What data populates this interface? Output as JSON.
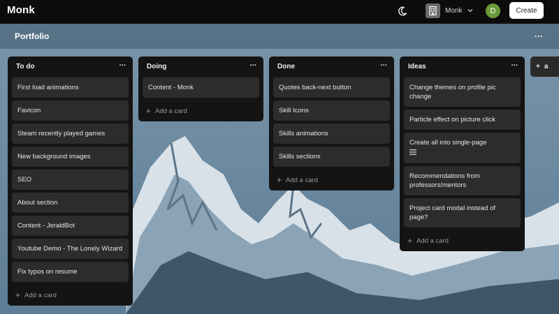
{
  "app": {
    "name": "Monk"
  },
  "topbar": {
    "workspace_name": "Monk",
    "avatar_initial": "D",
    "create_label": "Create",
    "theme_icon": "moon-icon"
  },
  "board": {
    "title": "Portfolio",
    "menu": "···"
  },
  "lists": [
    {
      "title": "To do",
      "menu": "···",
      "add_label": "Add a card",
      "cards": [
        "First load animations",
        "Favicon",
        "Steam recently played games",
        "New background images",
        "SEO",
        "About section",
        "Content - JeraldBot",
        "Youtube Demo - The Lonely Wizard",
        "Fix typos on resume"
      ]
    },
    {
      "title": "Doing",
      "menu": "···",
      "add_label": "Add a card",
      "cards": [
        "Content - Monk"
      ]
    },
    {
      "title": "Done",
      "menu": "···",
      "add_label": "Add a card",
      "cards": [
        "Quotes back-next button",
        "Skill Icons",
        "Skills animations",
        "Skills sections"
      ]
    },
    {
      "title": "Ideas",
      "menu": "···",
      "add_label": "Add a card",
      "cards": [
        "Change themes on profile pic change",
        "Particle effect on picture click",
        "Create all into single-page",
        "Recommendations from professors/mentors",
        "Project card modal instead of page?"
      ]
    }
  ],
  "add_list": {
    "label": "a"
  },
  "colors": {
    "topbar": "#0c0c0c",
    "list_bg": "#141414",
    "card_bg": "#2c2c2c",
    "avatar": "#6a9a3a"
  }
}
